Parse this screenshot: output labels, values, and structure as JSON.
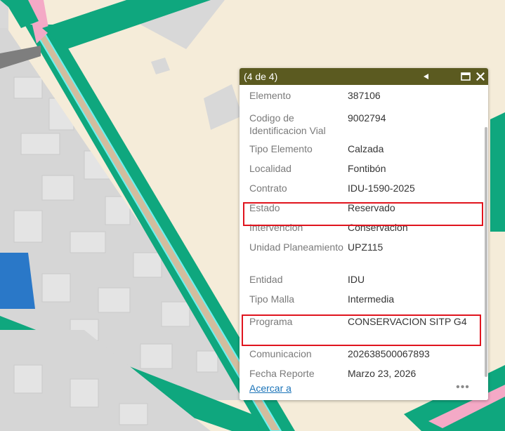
{
  "popup": {
    "count_label": "(4 de 4)",
    "prev_icon": "◀",
    "maximize_icon": "▭",
    "close_icon": "✕",
    "attributes": [
      {
        "key": "Elemento",
        "value": "387106"
      },
      {
        "key": "Codigo de Identificacion Vial",
        "value": "9002794"
      },
      {
        "key": "Tipo Elemento",
        "value": "Calzada"
      },
      {
        "key": "Localidad",
        "value": "Fontibón"
      },
      {
        "key": "Contrato",
        "value": "IDU-1590-2025"
      },
      {
        "key": "Estado",
        "value": "Reservado"
      },
      {
        "key": "Intervencion",
        "value": "Conservacion"
      },
      {
        "key": "Unidad Planeamiento",
        "value": "UPZ115"
      },
      {
        "key": "Entidad",
        "value": "IDU"
      },
      {
        "key": "Tipo Malla",
        "value": "Intermedia"
      },
      {
        "key": "Programa",
        "value": "CONSERVACION SITP G4"
      },
      {
        "key": "Comunicacion",
        "value": "202638500067893"
      },
      {
        "key": "Fecha Reporte",
        "value": "Marzo 23, 2026"
      }
    ],
    "zoom_link": "Acercar a",
    "more_icon": "•••"
  },
  "colors": {
    "header_bg": "#5b5a20",
    "highlight": "#e0141e",
    "link": "#1a73b8",
    "road_green": "#0fa77e",
    "road_tan": "#d2bd9e",
    "road_outline": "#6df2f2",
    "block_gray": "#d6d6d6",
    "building_gray": "#e2e2e2",
    "district_blue": "#2a78c8",
    "background_beige": "#f5ecd9",
    "pink": "#f4a9c6"
  }
}
